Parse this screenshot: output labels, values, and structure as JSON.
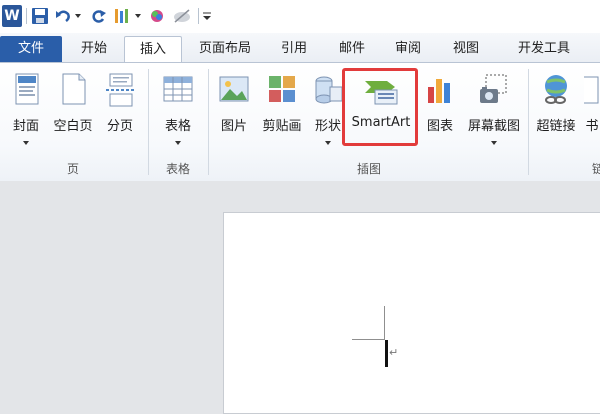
{
  "qat": {
    "app_icon_letter": "W",
    "icons": [
      "word-logo-icon",
      "save-icon",
      "undo-icon",
      "redo-icon",
      "format-painter-icon",
      "color-icon",
      "clear-format-icon",
      "customize-qat-icon"
    ]
  },
  "tabs": {
    "file": "文件",
    "home": "开始",
    "insert": "插入",
    "layout": "页面布局",
    "references": "引用",
    "mailings": "邮件",
    "review": "审阅",
    "view": "视图",
    "developer": "开发工具"
  },
  "ribbon": {
    "pages_group": {
      "label": "页",
      "cover": "封面",
      "blank_page": "空白页",
      "page_break": "分页"
    },
    "tables_group": {
      "label": "表格",
      "table": "表格"
    },
    "illustrations_group": {
      "label": "插图",
      "picture": "图片",
      "clip_art": "剪贴画",
      "shapes": "形状",
      "smartart": "SmartArt",
      "chart": "图表",
      "screenshot": "屏幕截图"
    },
    "links_group": {
      "hyperlink": "超链接",
      "partial_next": "书",
      "partial_label": "链"
    }
  },
  "document": {
    "paragraph_mark": "↵"
  },
  "colors": {
    "file_tab": "#2a5ea9",
    "highlight": "#e23b3b",
    "word_blue": "#2b579a"
  }
}
